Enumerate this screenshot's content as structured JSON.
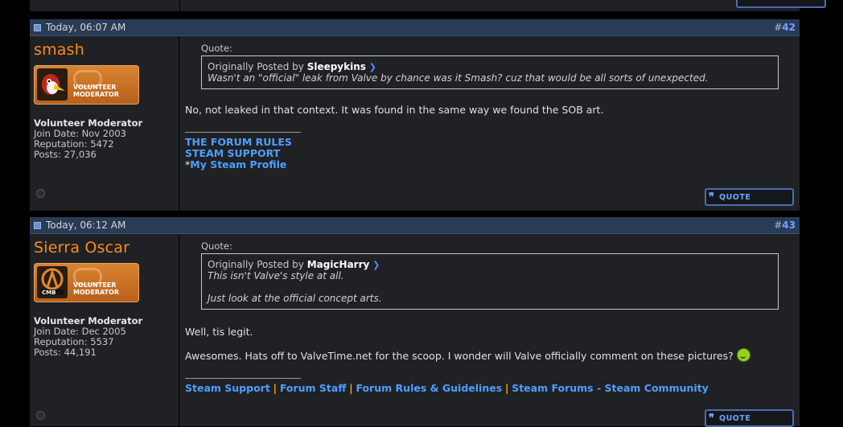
{
  "posts": [
    {
      "date": "Today, 06:07 AM",
      "number_prefix": "#",
      "number": "42",
      "username": "smash",
      "badge_line1": "VOLUNTEER",
      "badge_line2": "MODERATOR",
      "user_title": "Volunteer Moderator",
      "join_date": "Join Date: Nov 2003",
      "reputation": "Reputation: 5472",
      "posts": "Posts: 27,036",
      "quote_label": "Quote:",
      "quote_by_prefix": "Originally Posted by",
      "quote_author": "Sleepykins",
      "quote_lines": [
        "Wasn't an \"official\" leak from Valve by chance was it Smash? cuz that would be all sorts of unexpected."
      ],
      "message": [
        "No, not leaked in that context. It was found in the same way we found the SOB art."
      ],
      "signature_links": [
        "THE FORUM RULES",
        "STEAM SUPPORT",
        "My Steam Profile"
      ],
      "signature_prefix": "*",
      "quote_button": "QUOTE"
    },
    {
      "date": "Today, 06:12 AM",
      "number_prefix": "#",
      "number": "43",
      "username": "Sierra Oscar",
      "badge_line1": "VOLUNTEER",
      "badge_line2": "MODERATOR",
      "user_title": "Volunteer Moderator",
      "join_date": "Join Date: Dec 2005",
      "reputation": "Reputation: 5537",
      "posts": "Posts: 44,191",
      "quote_label": "Quote:",
      "quote_by_prefix": "Originally Posted by",
      "quote_author": "MagicHarry",
      "quote_lines": [
        "This isn't Valve's style at all.",
        "Just look at the official concept arts."
      ],
      "message": [
        "Well, tis legit.",
        "Awesomes. Hats off to ValveTime.net for the scoop. I wonder will Valve officially comment on these pictures?"
      ],
      "signature_links": [
        "Steam Support",
        "Forum Staff",
        "Forum Rules & Guidelines",
        "Steam Forums - Steam Community"
      ],
      "signature_sep": "|",
      "quote_button": "QUOTE"
    }
  ],
  "colors": {
    "username": "#ff8a1e",
    "link": "#4f9eff",
    "header_bg": "#2a3b55",
    "post_bg": "#1f2124"
  }
}
